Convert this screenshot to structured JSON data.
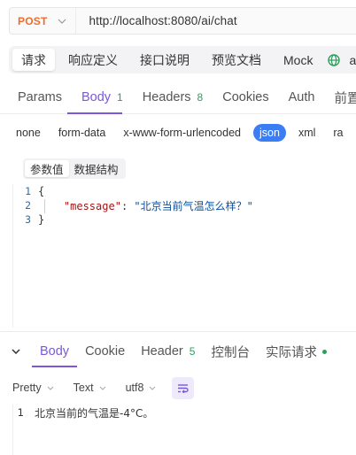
{
  "request": {
    "method": "POST",
    "url": "http://localhost:8080/ai/chat"
  },
  "top_tabs": [
    {
      "label": "请求"
    },
    {
      "label": "响应定义"
    },
    {
      "label": "接口说明"
    },
    {
      "label": "预览文档"
    },
    {
      "label": "Mock"
    }
  ],
  "top_tabs_tail": "a",
  "request_tabs": {
    "params": "Params",
    "body": "Body",
    "body_count": "1",
    "headers": "Headers",
    "headers_count": "8",
    "cookies": "Cookies",
    "auth": "Auth",
    "pre": "前置操"
  },
  "body_types": [
    "none",
    "form-data",
    "x-www-form-urlencoded",
    "json",
    "xml",
    "ra"
  ],
  "body_type_selected": "json",
  "segment": {
    "values": "参数值",
    "schema": "数据结构"
  },
  "editor": {
    "lines": [
      {
        "num": "1",
        "text": "{"
      },
      {
        "num": "2",
        "key": "\"message\"",
        "sep": ": ",
        "value": "\"北京当前气温怎么样？\""
      },
      {
        "num": "3",
        "text": "}"
      }
    ]
  },
  "response_tabs": {
    "body": "Body",
    "cookie": "Cookie",
    "header": "Header",
    "header_count": "5",
    "console": "控制台",
    "actual": "实际请求"
  },
  "response_format": {
    "pretty": "Pretty",
    "text": "Text",
    "encoding": "utf8"
  },
  "response_body": {
    "num": "1",
    "text": "北京当前的气温是-4°C。"
  },
  "colors": {
    "method": "#ef6c2e",
    "accent": "#7b57d9",
    "json_pill": "#3b7df2",
    "count_green": "#2e9e5b"
  }
}
